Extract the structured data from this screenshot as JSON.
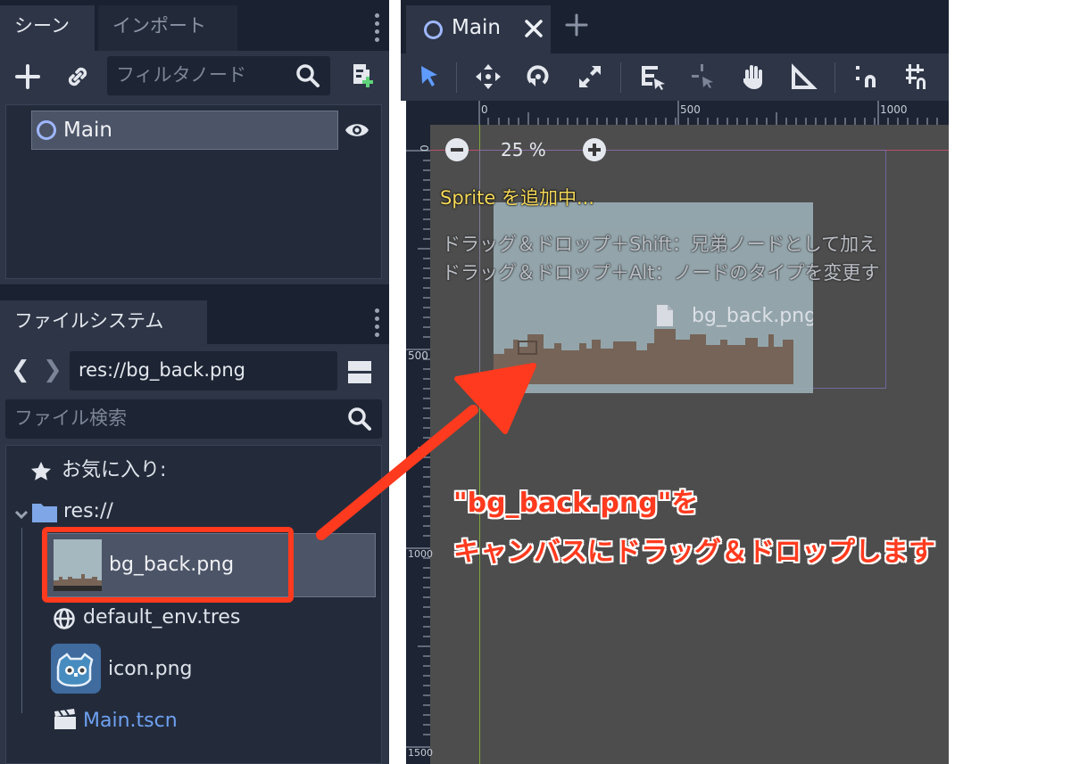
{
  "scene_dock": {
    "tabs": [
      {
        "label": "シーン",
        "active": true
      },
      {
        "label": "インポート",
        "active": false
      }
    ],
    "filter_placeholder": "フィルタノード",
    "root_node": {
      "label": "Main"
    }
  },
  "filesystem_dock": {
    "tab_label": "ファイルシステム",
    "path": "res://bg_back.png",
    "search_placeholder": "ファイル検索",
    "favorites_label": "お気に入り:",
    "root_label": "res://",
    "files": [
      {
        "name": "bg_back.png",
        "selected": true
      },
      {
        "name": "default_env.tres",
        "selected": false
      },
      {
        "name": "icon.png",
        "selected": false
      },
      {
        "name": "Main.tscn",
        "selected": false
      }
    ]
  },
  "editor": {
    "tab_label": "Main",
    "zoom_label": "25 %",
    "ruler_top": [
      "0",
      "500",
      "1000"
    ],
    "ruler_left": [
      "0",
      "500",
      "1000",
      "1500"
    ],
    "adding_label": "Sprite を追加中...",
    "hint_1": "ドラッグ＆ドロップ＋Shift：兄弟ノードとして加え",
    "hint_2": "ドラッグ＆ドロップ＋Alt：ノードのタイプを変更す",
    "drag_file_label": "bg_back.png"
  },
  "annotation": {
    "line_1": "\"bg_back.png\"を",
    "line_2": "キャンバスにドラッグ＆ドロップします",
    "color": "#ff3a1e"
  },
  "colors": {
    "dock_bg": "#1a2130",
    "panel_bg": "#2d3546",
    "accent_blue": "#5f9bff",
    "canvas_bg": "#4d4d4d",
    "hint_yellow": "#f5d95a",
    "script_file_blue": "#6ea0f0"
  }
}
